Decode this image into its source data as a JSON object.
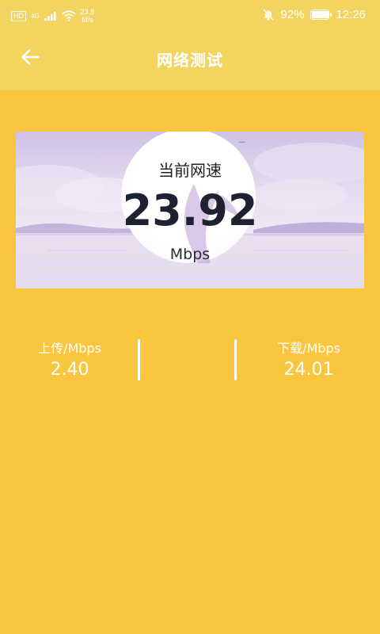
{
  "status_bar": {
    "network_speed_value": "23.8",
    "network_speed_unit": "M/s",
    "signal_label": "4G",
    "battery_percent": "92%",
    "time": "12:26"
  },
  "header": {
    "title": "网络测试"
  },
  "speed_card": {
    "label": "当前网速",
    "value": "23.92",
    "unit": "Mbps"
  },
  "stats": {
    "upload_label": "上传/Mbps",
    "upload_value": "2.40",
    "download_label": "下载/Mbps",
    "download_value": "24.01"
  },
  "colors": {
    "background": "#FAC640",
    "header": "#F2D45E",
    "text_on_bg": "#FFFFFF"
  }
}
